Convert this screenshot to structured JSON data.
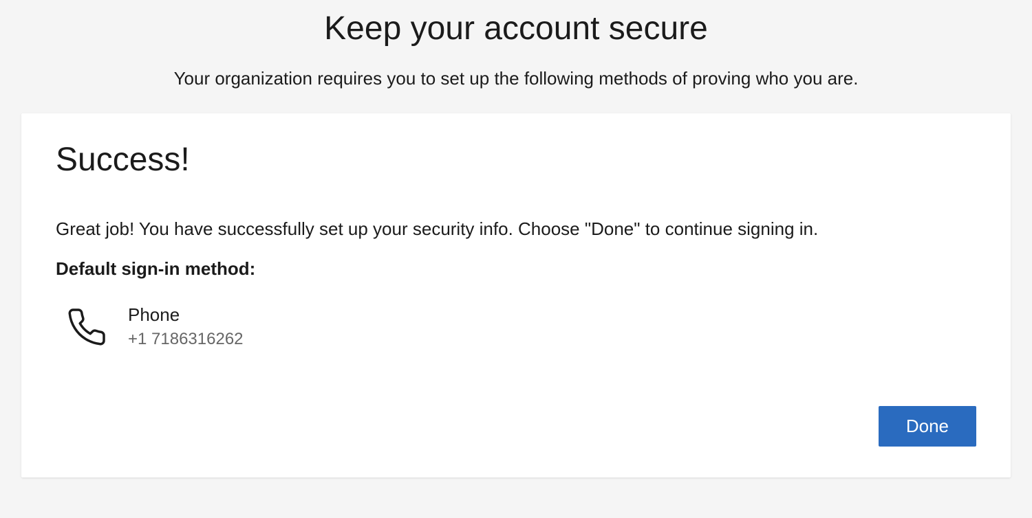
{
  "header": {
    "title": "Keep your account secure",
    "subtitle": "Your organization requires you to set up the following methods of proving who you are."
  },
  "card": {
    "success_title": "Success!",
    "success_message": "Great job! You have successfully set up your security info. Choose \"Done\" to continue signing in.",
    "default_method_label": "Default sign-in method:",
    "method": {
      "name": "Phone",
      "value": "+1 7186316262"
    },
    "done_label": "Done"
  }
}
